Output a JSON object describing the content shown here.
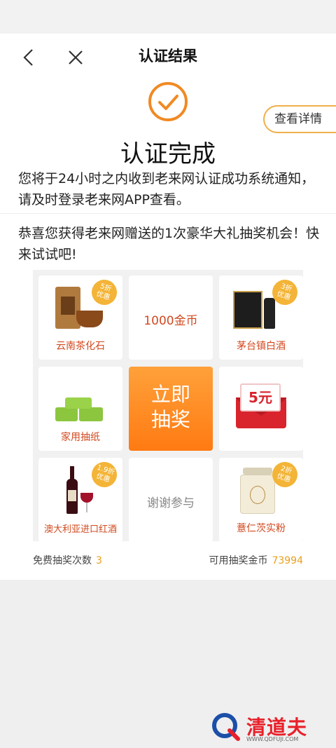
{
  "header": {
    "title": "认证结果"
  },
  "result": {
    "title": "认证完成",
    "message": "您将于24小时之内收到老来网认证成功系统通知，请及时登录老来网APP查看。",
    "detail_button": "查看详情"
  },
  "promo": {
    "text": "恭喜您获得老来网赠送的1次豪华大礼抽奖机会！快来试试吧!"
  },
  "lottery": {
    "draw_button": [
      "立即",
      "抽奖"
    ],
    "prizes": [
      {
        "label": "云南茶化石",
        "badge": [
          "5折",
          "优惠"
        ]
      },
      {
        "label": "1000金币"
      },
      {
        "label": "茅台镇白酒",
        "badge": [
          "3折",
          "优惠"
        ]
      },
      {
        "label": "家用抽纸"
      },
      {
        "label": "5元",
        "sub": ""
      },
      {
        "label": "澳大利亚进口红酒",
        "badge": [
          "1.9折",
          "优惠"
        ]
      },
      {
        "label": "谢谢参与"
      },
      {
        "label": "薏仁茨实粉",
        "badge": [
          "2折",
          "优惠"
        ]
      }
    ]
  },
  "counters": {
    "free_label": "免费抽奖次数",
    "free_value": "3",
    "coins_label": "可用抽奖金币",
    "coins_value": "73994"
  },
  "watermark": {
    "text": "清道夫",
    "sub": "WWW.QDFUJI.COM"
  },
  "colors": {
    "accent": "#f08a24",
    "prize_text": "#d2491f",
    "coin_value": "#e8a020"
  }
}
